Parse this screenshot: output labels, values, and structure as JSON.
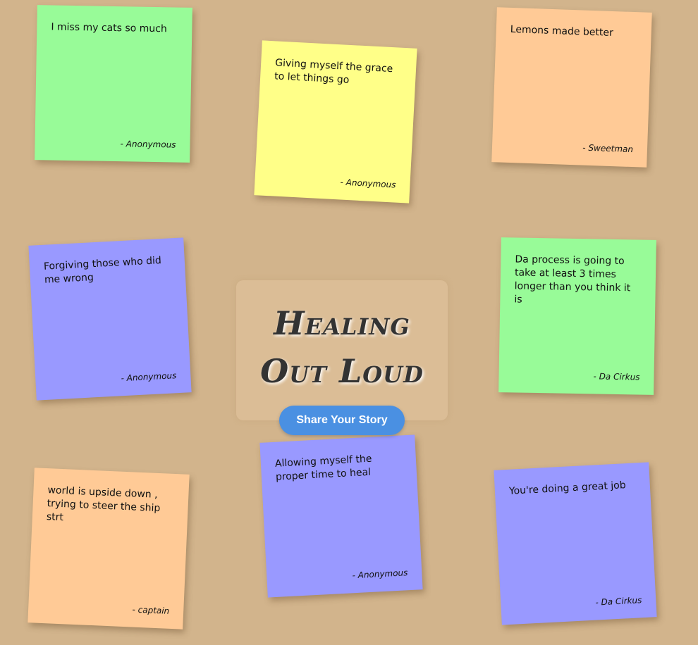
{
  "hero": {
    "title_line1": "Healing",
    "title_line2": "Out Loud",
    "share_button_label": "Share Your Story"
  },
  "notes": [
    {
      "text": "I miss my cats so much",
      "author": "- Anonymous",
      "color": "#98fb98"
    },
    {
      "text": "Giving myself the grace to let things go",
      "author": "- Anonymous",
      "color": "#ffff88"
    },
    {
      "text": "Lemons made better",
      "author": "- Sweetman",
      "color": "#ffca96"
    },
    {
      "text": "Forgiving those who did me wrong",
      "author": "- Anonymous",
      "color": "#9999ff"
    },
    {
      "text": "Da process is going to take at least 3 times longer than you think it is",
      "author": "- Da Cirkus",
      "color": "#98fb98"
    },
    {
      "text": "world is upside down , trying to steer the ship strt",
      "author": "- captain",
      "color": "#ffca96"
    },
    {
      "text": "Allowing myself the proper time to heal",
      "author": "- Anonymous",
      "color": "#9999ff"
    },
    {
      "text": "You're doing a great job",
      "author": "- Da Cirkus",
      "color": "#9999ff"
    }
  ],
  "colors": {
    "background": "#d2b48c",
    "button": "#4a90e2"
  }
}
